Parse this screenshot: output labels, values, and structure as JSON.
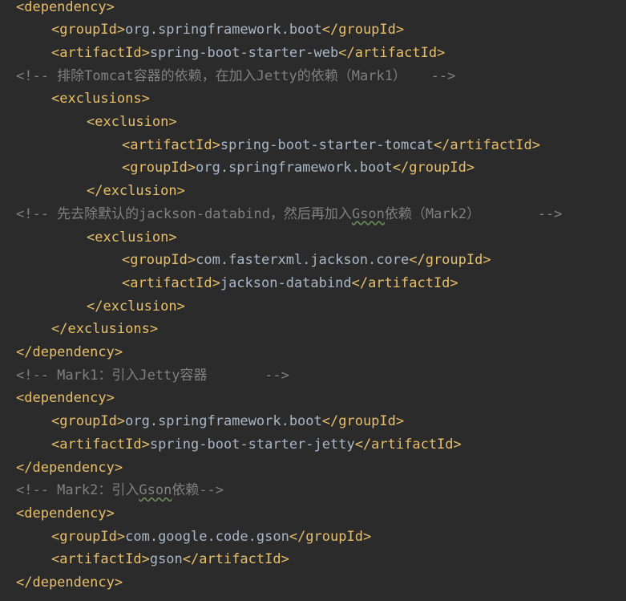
{
  "lines": [
    {
      "indent": 0,
      "kind": "tag",
      "parts": [
        {
          "t": "tag",
          "v": "<dependency>"
        }
      ]
    },
    {
      "indent": 1,
      "kind": "tag",
      "parts": [
        {
          "t": "tag",
          "v": "<groupId>"
        },
        {
          "t": "text",
          "v": "org.springframework.boot"
        },
        {
          "t": "tag",
          "v": "</groupId>"
        }
      ]
    },
    {
      "indent": 1,
      "kind": "tag",
      "parts": [
        {
          "t": "tag",
          "v": "<artifactId>"
        },
        {
          "t": "text",
          "v": "spring-boot-starter-web"
        },
        {
          "t": "tag",
          "v": "</artifactId>"
        }
      ]
    },
    {
      "indent": 0,
      "kind": "comment",
      "parts": [
        {
          "t": "comment",
          "v": "<!-- 排除Tomcat容器的依赖，在加入Jetty的依赖（Mark1）   -->"
        }
      ]
    },
    {
      "indent": 1,
      "kind": "tag",
      "parts": [
        {
          "t": "tag",
          "v": "<exclusions>"
        }
      ]
    },
    {
      "indent": 2,
      "kind": "tag",
      "parts": [
        {
          "t": "tag",
          "v": "<exclusion>"
        }
      ]
    },
    {
      "indent": 3,
      "kind": "tag",
      "parts": [
        {
          "t": "tag",
          "v": "<artifactId>"
        },
        {
          "t": "text",
          "v": "spring-boot-starter-tomcat"
        },
        {
          "t": "tag",
          "v": "</artifactId>"
        }
      ]
    },
    {
      "indent": 3,
      "kind": "tag",
      "parts": [
        {
          "t": "tag",
          "v": "<groupId>"
        },
        {
          "t": "text",
          "v": "org.springframework.boot"
        },
        {
          "t": "tag",
          "v": "</groupId>"
        }
      ]
    },
    {
      "indent": 2,
      "kind": "tag",
      "parts": [
        {
          "t": "tag",
          "v": "</exclusion>"
        }
      ]
    },
    {
      "indent": 0,
      "kind": "comment",
      "parts": [
        {
          "t": "comment",
          "v": "<!-- 先去除默认的jackson-databind，然后再加入"
        },
        {
          "t": "comment-squiggle",
          "v": "Gson"
        },
        {
          "t": "comment",
          "v": "依赖（Mark2）       -->"
        }
      ]
    },
    {
      "indent": 2,
      "kind": "tag",
      "parts": [
        {
          "t": "tag",
          "v": "<exclusion>"
        }
      ]
    },
    {
      "indent": 3,
      "kind": "tag",
      "parts": [
        {
          "t": "tag",
          "v": "<groupId>"
        },
        {
          "t": "text",
          "v": "com.fasterxml.jackson.core"
        },
        {
          "t": "tag",
          "v": "</groupId>"
        }
      ]
    },
    {
      "indent": 3,
      "kind": "tag",
      "parts": [
        {
          "t": "tag",
          "v": "<artifactId>"
        },
        {
          "t": "text",
          "v": "jackson-databind"
        },
        {
          "t": "tag",
          "v": "</artifactId>"
        }
      ]
    },
    {
      "indent": 2,
      "kind": "tag",
      "parts": [
        {
          "t": "tag",
          "v": "</exclusion>"
        }
      ]
    },
    {
      "indent": 1,
      "kind": "tag",
      "parts": [
        {
          "t": "tag",
          "v": "</exclusions>"
        }
      ]
    },
    {
      "indent": 0,
      "kind": "tag",
      "parts": [
        {
          "t": "tag",
          "v": "</dependency>"
        }
      ]
    },
    {
      "indent": 0,
      "kind": "comment",
      "parts": [
        {
          "t": "comment",
          "v": "<!-- Mark1：引入Jetty容器       -->"
        }
      ]
    },
    {
      "indent": 0,
      "kind": "tag",
      "parts": [
        {
          "t": "tag",
          "v": "<dependency>"
        }
      ]
    },
    {
      "indent": 1,
      "kind": "tag",
      "parts": [
        {
          "t": "tag",
          "v": "<groupId>"
        },
        {
          "t": "text",
          "v": "org.springframework.boot"
        },
        {
          "t": "tag",
          "v": "</groupId>"
        }
      ]
    },
    {
      "indent": 1,
      "kind": "tag",
      "parts": [
        {
          "t": "tag",
          "v": "<artifactId>"
        },
        {
          "t": "text",
          "v": "spring-boot-starter-jetty"
        },
        {
          "t": "tag",
          "v": "</artifactId>"
        }
      ]
    },
    {
      "indent": 0,
      "kind": "tag",
      "parts": [
        {
          "t": "tag",
          "v": "</dependency>"
        }
      ]
    },
    {
      "indent": 0,
      "kind": "comment",
      "parts": [
        {
          "t": "comment",
          "v": "<!-- Mark2：引入"
        },
        {
          "t": "comment-squiggle",
          "v": "Gson"
        },
        {
          "t": "comment",
          "v": "依赖-->"
        }
      ]
    },
    {
      "indent": 0,
      "kind": "tag",
      "parts": [
        {
          "t": "tag",
          "v": "<dependency>"
        }
      ]
    },
    {
      "indent": 1,
      "kind": "tag",
      "parts": [
        {
          "t": "tag",
          "v": "<groupId>"
        },
        {
          "t": "text",
          "v": "com.google.code.gson"
        },
        {
          "t": "tag",
          "v": "</groupId>"
        }
      ]
    },
    {
      "indent": 1,
      "kind": "tag",
      "parts": [
        {
          "t": "tag",
          "v": "<artifactId>"
        },
        {
          "t": "text",
          "v": "gson"
        },
        {
          "t": "tag",
          "v": "</artifactId>"
        }
      ]
    },
    {
      "indent": 0,
      "kind": "tag",
      "parts": [
        {
          "t": "tag",
          "v": "</dependency>"
        }
      ]
    }
  ],
  "colors": {
    "background": "#2b2b2b",
    "tag": "#e8bf6a",
    "text": "#a9b7c6",
    "comment": "#808080"
  }
}
